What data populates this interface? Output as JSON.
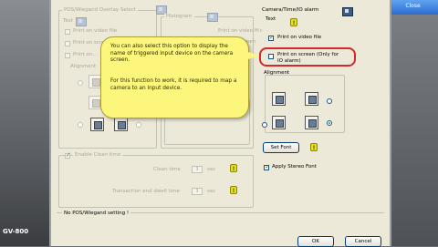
{
  "window": {
    "corner_button_label": "Close",
    "brand_label": "GV-800"
  },
  "pos_group": {
    "title": "POS/Wiegand Overlay Select",
    "text_label": "Text",
    "options": [
      "Print on video file",
      "Print on screen",
      "Print on..."
    ],
    "alignment_label": "Alignment"
  },
  "histogram_group": {
    "title": "Histogram",
    "options": [
      "Print on video file",
      "Print on screen"
    ]
  },
  "enable_clean": {
    "label": "Enable Clean time",
    "clean_time_label": "Clean time",
    "clean_time_value": "3",
    "clean_time_unit": "sec",
    "transaction_label": "Transaction end dwell time",
    "transaction_value": "3",
    "transaction_unit": "sec"
  },
  "camera_group": {
    "title": "Camera/Time/IO alarm",
    "text_label": "Text",
    "print_on_video_file": "Print on video file",
    "print_on_screen": "Print on screen (Only for IO alarm)",
    "alignment_label": "Alignment"
  },
  "tooltip": {
    "paragraph1": "You can also select this option to display the name of triggered input device on the camera screen.",
    "paragraph2": "For this function to work, it is required to map a camera to an input device."
  },
  "buttons": {
    "set_font": "Set Font",
    "apply_stereo_font": "Apply Stereo Font",
    "ok": "OK",
    "cancel": "Cancel"
  },
  "status": {
    "message": "No POS/Wiegand setting !"
  },
  "colors": {
    "dialog_bg": "#ece9d8",
    "tooltip_bg": "#fcf67c",
    "highlight": "#d3282c",
    "check_green": "#21a121"
  }
}
